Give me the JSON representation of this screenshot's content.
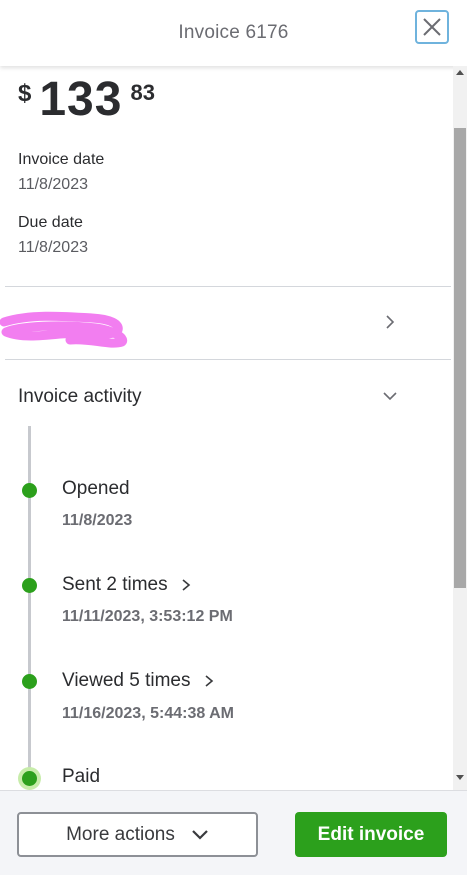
{
  "header": {
    "title": "Invoice 6176",
    "close_icon": "close-icon"
  },
  "amount": {
    "currency": "$",
    "whole": "133",
    "cents": "83"
  },
  "fields": [
    {
      "label": "Invoice date",
      "value": "11/8/2023"
    },
    {
      "label": "Due date",
      "value": "11/8/2023"
    }
  ],
  "customer": {
    "redacted": true,
    "icon": "chevron-right-icon"
  },
  "activity": {
    "title": "Invoice activity",
    "events": [
      {
        "title": "Opened",
        "date": "11/8/2023",
        "has_chevron": false
      },
      {
        "title": "Sent 2 times",
        "date": "11/11/2023, 3:53:12 PM",
        "has_chevron": true
      },
      {
        "title": "Viewed 5 times",
        "date": "11/16/2023, 5:44:38 AM",
        "has_chevron": true
      },
      {
        "title": "Paid",
        "date": "",
        "has_chevron": false
      }
    ]
  },
  "footer": {
    "more_actions": "More actions",
    "edit_invoice": "Edit invoice"
  },
  "colors": {
    "accent_green": "#2ca01c",
    "paid_halo": "#c7ecaa",
    "close_border": "#6fb3dd",
    "redaction": "#f27ef0"
  }
}
